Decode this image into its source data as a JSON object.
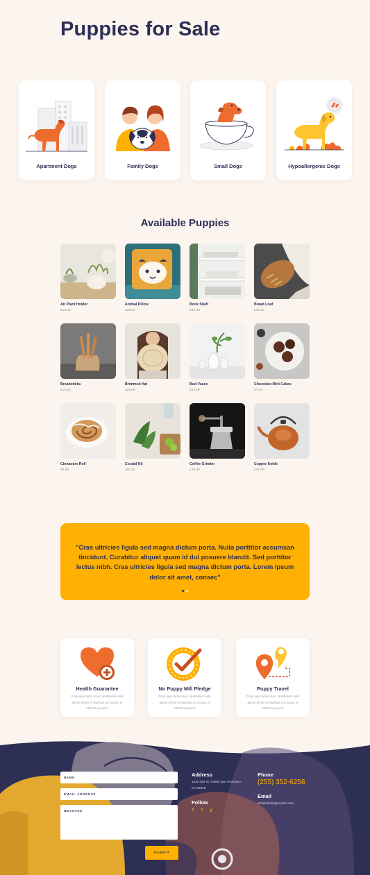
{
  "page_title": "Puppies for Sale",
  "categories": [
    {
      "label": "Apartment Dogs",
      "icon": "apartment-dog-illustration"
    },
    {
      "label": "Family Dogs",
      "icon": "family-dog-illustration"
    },
    {
      "label": "Small Dogs",
      "icon": "small-dog-teacup-illustration"
    },
    {
      "label": "Hypoallergenic Dogs",
      "icon": "hypoallergenic-dog-illustration"
    }
  ],
  "products_title": "Available Puppies",
  "products": [
    {
      "name": "Air Plant Holder",
      "price": "£14.00"
    },
    {
      "name": "Animal Pillow",
      "price": "£28.00"
    },
    {
      "name": "Book Shelf",
      "price": "£99.00"
    },
    {
      "name": "Bread Loaf",
      "price": "£12.00"
    },
    {
      "name": "Breadsticks",
      "price": "£14.00"
    },
    {
      "name": "Brimmed Hat",
      "price": "£25.00"
    },
    {
      "name": "Bud Vases",
      "price": "£22.00"
    },
    {
      "name": "Chocolate Mini Cakes",
      "price": "£7.00"
    },
    {
      "name": "Cinnamon Roll",
      "price": "£8.00"
    },
    {
      "name": "Coctail Kit",
      "price": "£60.00"
    },
    {
      "name": "Coffee Grinder",
      "price": "£30.00"
    },
    {
      "name": "Copper Kettle",
      "price": "£47.00"
    }
  ],
  "testimonial": {
    "quote": "\"Cras ultricies ligula sed magna dictum porta. Nulla porttitor accumsan tincidunt. Curabitur aliquet quam id dui posuere blandit. Sed porttitor lectus nibh. Cras ultricies ligula sed magna dictum porta. Lorem ipsum dolor sit amet, consec\"",
    "slides": 2,
    "active_slide": 1
  },
  "features": [
    {
      "title": "Health Guarantee",
      "text": "Proin eget tortor risus. Vestibulum ante ipsum primis in faucibus orci luctus et ultrices posuere",
      "icon": "heart-plus-icon"
    },
    {
      "title": "No Puppy Mill Pledge",
      "text": "Proin eget tortor risus. Vestibulum ante ipsum primis in faucibus orci luctus et ultrices posuere",
      "icon": "checkmark-seal-icon"
    },
    {
      "title": "Puppy Travel",
      "text": "Proin eget tortor risus. Vestibulum ante ipsum primis in faucibus orci luctus et ultrices posuere",
      "icon": "map-pins-icon"
    }
  ],
  "form": {
    "name_label": "NAME",
    "email_label": "EMAIL ADDRESS",
    "message_label": "MESSAGE",
    "submit_label": "SUBMIT"
  },
  "contact": {
    "address_heading": "Address",
    "address_line1": "1234 Divi St. #1000 San Francisco,",
    "address_line2": "CA 93945",
    "follow_heading": "Follow",
    "phone_heading": "Phone",
    "phone": "(255) 352-6258",
    "email_heading": "Email",
    "email": "info@dividogbreeder.com",
    "social": [
      "f",
      "t",
      "y"
    ]
  },
  "colors": {
    "background": "#fcf5ef",
    "navy": "#2e2f55",
    "accent": "#ffb000",
    "orange": "#ef6c2f"
  }
}
